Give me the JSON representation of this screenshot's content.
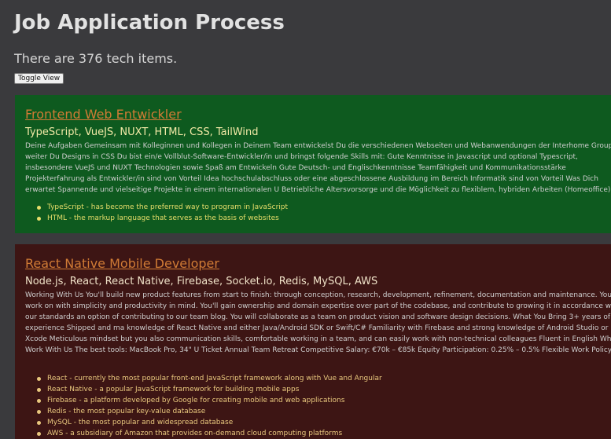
{
  "header": {
    "title": "Job Application Process",
    "count_text": "There are 376 tech items.",
    "toggle_label": "Toggle View"
  },
  "colors": {
    "background": "#3a3a3d",
    "card_green": "#0e5a1f",
    "card_red": "#3d1514",
    "title_link": "#d07b35"
  },
  "jobs": [
    {
      "title": "Frontend Web Entwickler",
      "skills": "TypeScript, VueJS, NUXT, HTML, CSS, TailWind",
      "description": "Deine Aufgaben Gemeinsam mit Kolleginnen und Kollegen in Deinem Team entwickelst Du die verschiedenen Webseiten und Webanwendungen der Interhome Group weiter Du Designs in CSS Du bist ein/e Vollblut-Software-Entwickler/in und bringst folgende Skills mit: Gute Kenntnisse in Javascript und optional Typescript, insbesondere VueJS und NUXT Technologien sowie Spaß am Entwickeln Gute Deutsch- und Englischkenntnisse Teamfähigkeit und Kommunikationsstärke Projekterfahrung als Entwickler/in sind von Vorteil Idea hochschulabschluss oder eine abgeschlossene Ausbildung im Bereich Informatik sind von Vorteil Was Dich erwartet Spannende und vielseitige Projekte in einem internationalen U Betriebliche Altersvorsorge und die Möglichkeit zu flexiblem, hybriden Arbeiten (Homeoffice) Attraktive Mitarbeiterrabatte und Sportangebote (Hansefit)",
      "tech_items": [
        "TypeScript - has become the preferred way to program in JavaScript",
        "HTML - the markup language that serves as the basis of websites"
      ]
    },
    {
      "title": "React Native Mobile Developer",
      "skills": "Node.js, React, React Native, Firebase, Socket.io, Redis, MySQL, AWS",
      "description": "Working With Us You'll build new product features from start to finish: through conception, research, development, refinement, documentation and maintenance. You'll work on with simplicity and productivity in mind. You'll gain ownership and domain expertise over part of the codebase, and contribute to growing it in accordance with our standards an option of contributing to our team blog. You will collaborate as a team on product vision and software design decisions. What You Bring 3+ years of experience Shipped and ma knowledge of React Native and either Java/Android SDK or Swift/C# Familiarity with Firebase and strong knowledge of Android Studio or Xcode Meticulous mindset but you also communication skills, comfortable working in a team, and can easily work with non-technical colleagues Fluent in English Why Work With Us The best tools: MacBook Pro, 34\" U Ticket Annual Team Retreat Competitive Salary: €70k – €85k Equity Participation: 0.25% – 0.5% Flexible Work Policy",
      "tech_items": [
        "React - currently the most popular front-end JavaScript framework along with Vue and Angular",
        "React Native - a popular JavaScript framework for building mobile apps",
        "Firebase - a platform developed by Google for creating mobile and web applications",
        "Redis - the most popular key-value database",
        "MySQL - the most popular and widespread database",
        "AWS - a subsidiary of Amazon that provides on-demand cloud computing platforms"
      ]
    }
  ]
}
